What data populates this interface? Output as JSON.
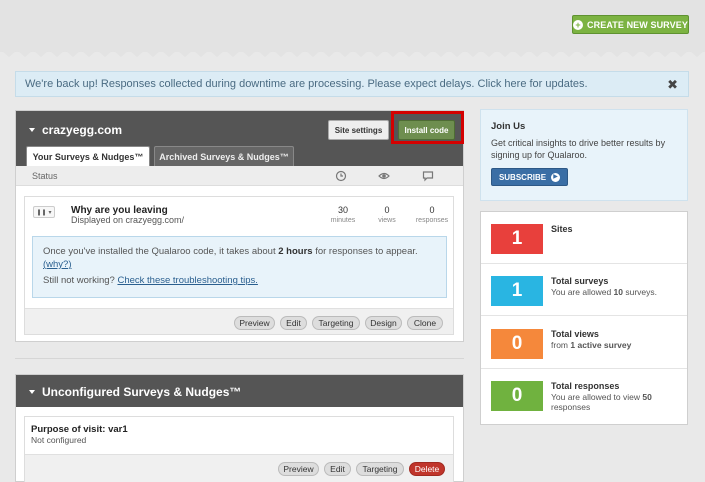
{
  "header": {
    "create_label": "CREATE NEW SURVEY"
  },
  "alert": {
    "text": "We're back up! Responses collected during downtime are processing. Please expect delays. Click here for updates.",
    "close": "✖"
  },
  "site": {
    "name": "crazyegg.com",
    "site_settings_label": "Site settings",
    "install_code_label": "Install code",
    "tabs": [
      "Your Surveys & Nudges™",
      "Archived Surveys & Nudges™"
    ],
    "status_label": "Status",
    "survey": {
      "name": "Why are you leaving",
      "subtitle": "Displayed on crazyegg.com/",
      "minutes_value": "30",
      "minutes_label": "minutes",
      "views_value": "0",
      "views_label": "views",
      "responses_value": "0",
      "responses_label": "responses",
      "info_line1_pre": "Once you've installed the Qualaroo code, it takes about ",
      "info_line1_bold": "2 hours",
      "info_line1_post": " for responses to appear.",
      "info_why": "(why?)",
      "info_line2_pre": "Still not working? ",
      "info_line2_link": "Check these troubleshooting tips.",
      "actions": [
        "Preview",
        "Edit",
        "Targeting",
        "Design",
        "Clone"
      ]
    }
  },
  "unconfigured": {
    "title": "Unconfigured Surveys & Nudges™",
    "survey": {
      "name": "Purpose of visit: var1",
      "subtitle": "Not configured",
      "actions": [
        "Preview",
        "Edit",
        "Targeting",
        "Delete"
      ]
    }
  },
  "join": {
    "title": "Join Us",
    "text": "Get critical insights to drive better results by signing up for Qualaroo.",
    "subscribe_label": "SUBSCRIBE"
  },
  "stats": [
    {
      "value": "1",
      "title": "Sites",
      "desc": "",
      "color": "#e8403c"
    },
    {
      "value": "1",
      "title": "Total surveys",
      "desc_pre": "You are allowed ",
      "desc_bold": "10",
      "desc_post": " surveys.",
      "color": "#29b5e2"
    },
    {
      "value": "0",
      "title": "Total views",
      "desc_pre": "from ",
      "desc_bold": "1 active survey",
      "desc_post": "",
      "color": "#f5883b"
    },
    {
      "value": "0",
      "title": "Total responses",
      "desc_pre": "You are allowed to view ",
      "desc_bold": "50",
      "desc_post": " responses",
      "color": "#70b23f"
    }
  ]
}
